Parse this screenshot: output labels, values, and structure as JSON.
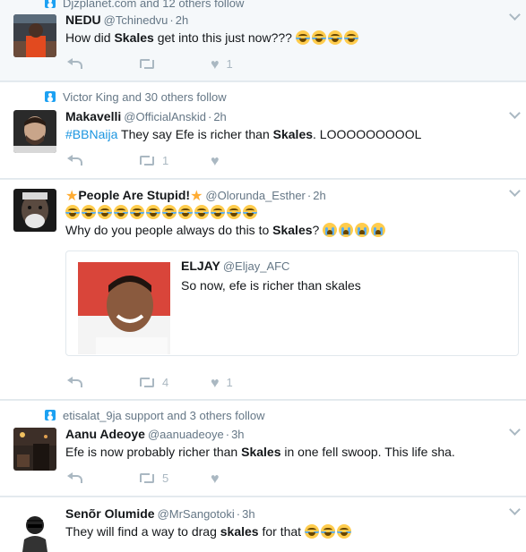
{
  "tweets": [
    {
      "context": "Djzplanet.com and 12 others follow",
      "name": "NEDU",
      "handle": "@Tchinedvu",
      "time": "2h",
      "text_before": "How did ",
      "bold": "Skales",
      "text_after": " get into this just now??? ",
      "emojis": [
        "face-with-tears-of-joy",
        "face-with-tears-of-joy",
        "face-with-tears-of-joy",
        "face-with-tears-of-joy"
      ],
      "retweets": "",
      "likes": "1"
    },
    {
      "context": "Victor King and 30 others follow",
      "name": "Makavelli",
      "handle": "@OfficialAnskid",
      "time": "2h",
      "hashtag": "#BBNaija",
      "text_before": " They say Efe is richer than ",
      "bold": "Skales",
      "text_after": ". LOOOOOOOOOL",
      "retweets": "1",
      "likes": ""
    },
    {
      "name": "People Are Stupid!",
      "handle": "@Olorunda_Esther",
      "time": "2h",
      "line1_emojis": [
        "face-with-tears-of-joy",
        "face-with-tears-of-joy",
        "face-with-tears-of-joy",
        "face-with-tears-of-joy",
        "face-with-tears-of-joy",
        "face-with-tears-of-joy",
        "face-with-tears-of-joy",
        "face-with-tears-of-joy",
        "face-with-tears-of-joy",
        "face-with-tears-of-joy",
        "face-with-tears-of-joy",
        "face-with-tears-of-joy"
      ],
      "text_before": "Why do you people always do this to ",
      "bold": "Skales",
      "text_after": "? ",
      "emojis": [
        "loudly-crying-face",
        "loudly-crying-face",
        "loudly-crying-face",
        "loudly-crying-face"
      ],
      "quote": {
        "name": "ELJAY",
        "handle": "@Eljay_AFC",
        "text": "So now, efe is richer than skales"
      },
      "retweets": "4",
      "likes": "1"
    },
    {
      "context": "etisalat_9ja support and 3 others follow",
      "name": "Aanu Adeoye",
      "handle": "@aanuadeoye",
      "time": "3h",
      "text_before": "Efe is now probably richer than ",
      "bold": "Skales",
      "text_after": " in one fell swoop. This life sha.",
      "retweets": "5",
      "likes": ""
    },
    {
      "name": "Senõr Olumide",
      "handle": "@MrSangotoki",
      "time": "3h",
      "text_before": "They will find a way to drag ",
      "bold": "skales",
      "text_after": " for that ",
      "emojis": [
        "face-with-tears-of-joy",
        "face-with-tears-of-joy",
        "face-with-tears-of-joy"
      ]
    }
  ],
  "separator": "·",
  "colors": {
    "link": "#1b95e0",
    "muted": "#657786",
    "icon": "#aab8c2",
    "background": "#e6ecf0"
  }
}
